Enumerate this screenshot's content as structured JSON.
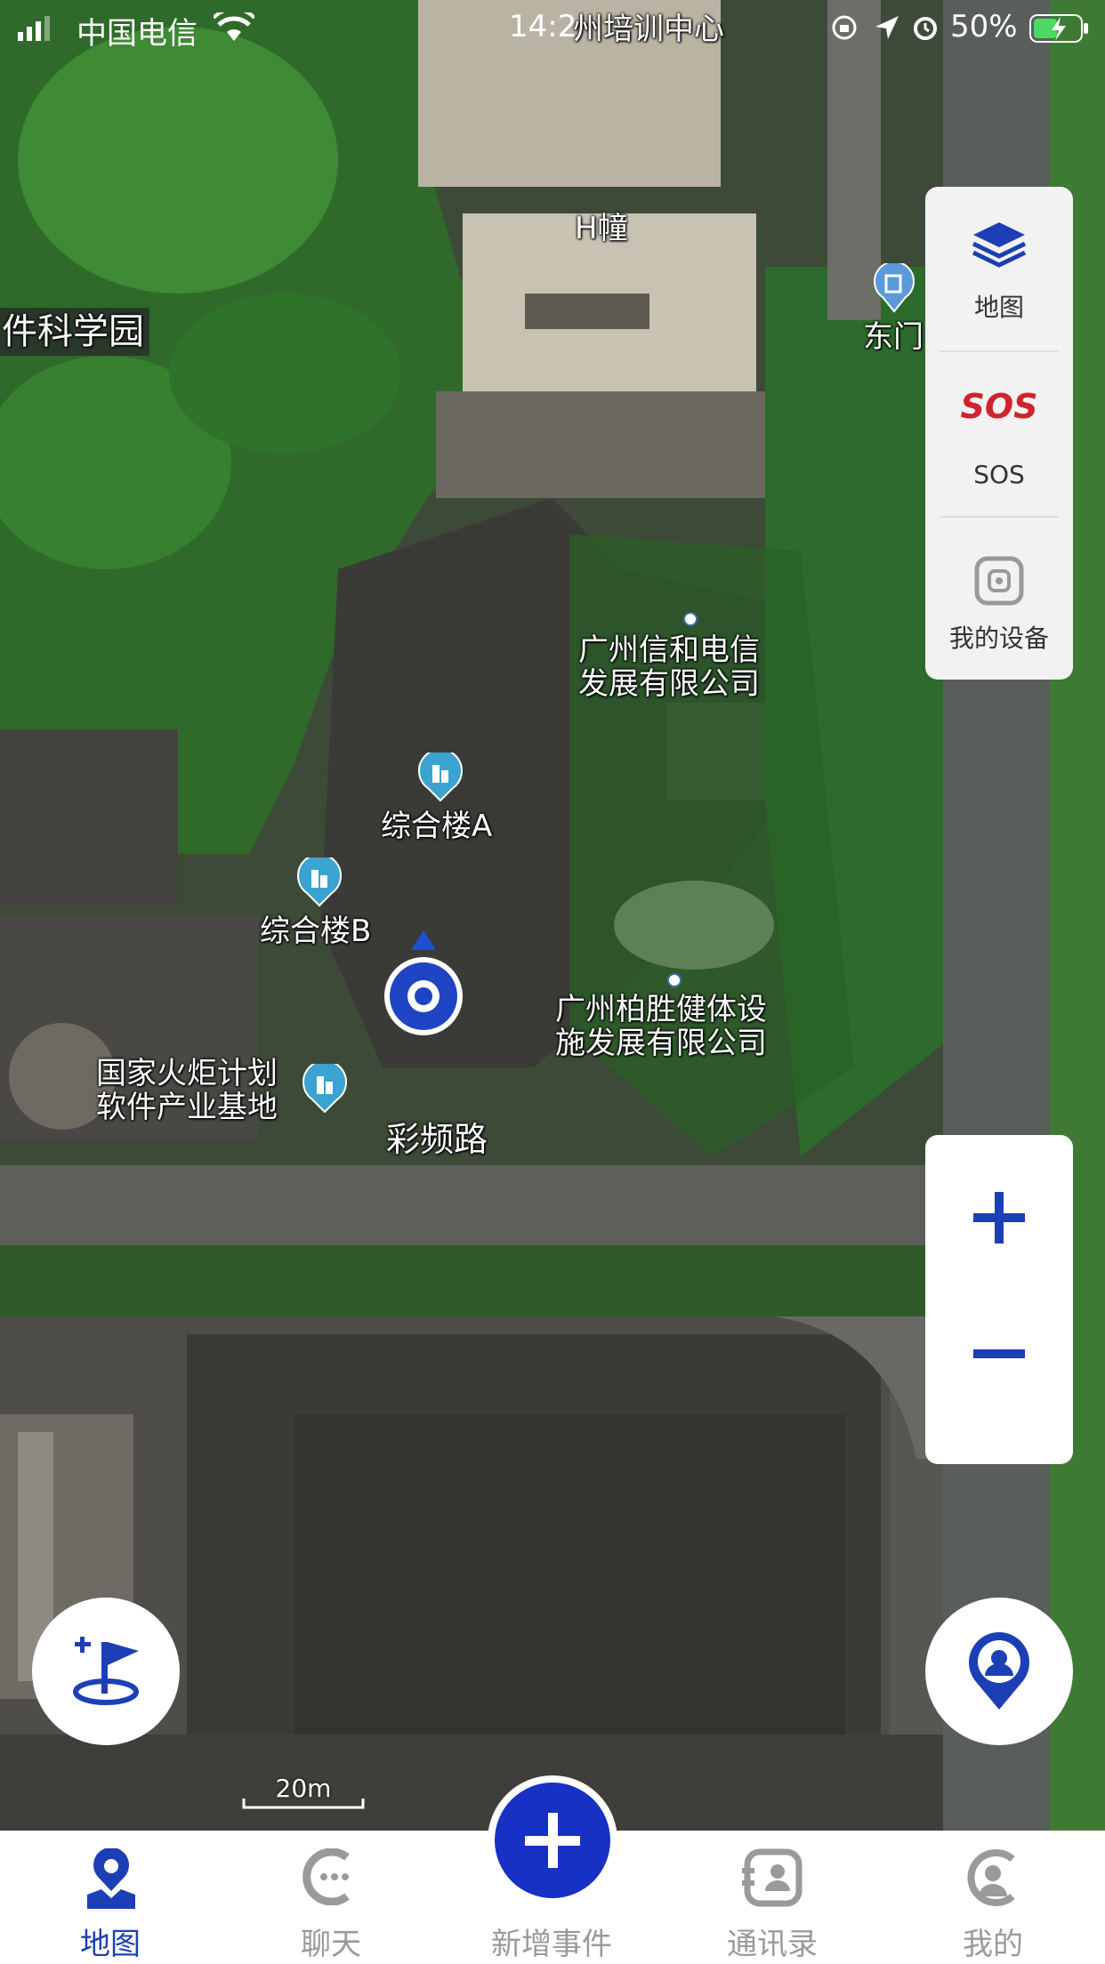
{
  "status_bar": {
    "carrier": "中国电信",
    "time": "14:2",
    "battery": "50%"
  },
  "map": {
    "labels": {
      "top_center": "州培训中心",
      "h_building": "H幢",
      "science_park": "件科学园",
      "east_gate": "东门",
      "company_1": "广州信和电信\n发展有限公司",
      "building_a": "综合楼A",
      "building_b": "综合楼B",
      "company_2": "广州柏胜健体设\n施发展有限公司",
      "torch_base": "国家火炬计划\n软件产业基地",
      "road": "彩频路"
    },
    "scale_label": "20m"
  },
  "right_panel": {
    "map_label": "地图",
    "sos_label": "SOS",
    "devices_label": "我的设备"
  },
  "tabs": [
    {
      "label": "地图",
      "icon": "map-pin-icon",
      "active": true
    },
    {
      "label": "聊天",
      "icon": "chat-icon",
      "active": false
    },
    {
      "label": "新增事件",
      "icon": "plus-icon",
      "active": false
    },
    {
      "label": "通讯录",
      "icon": "contacts-icon",
      "active": false
    },
    {
      "label": "我的",
      "icon": "profile-icon",
      "active": false
    }
  ],
  "colors": {
    "accent": "#1d3fb6",
    "sos_red": "#d0232b"
  }
}
